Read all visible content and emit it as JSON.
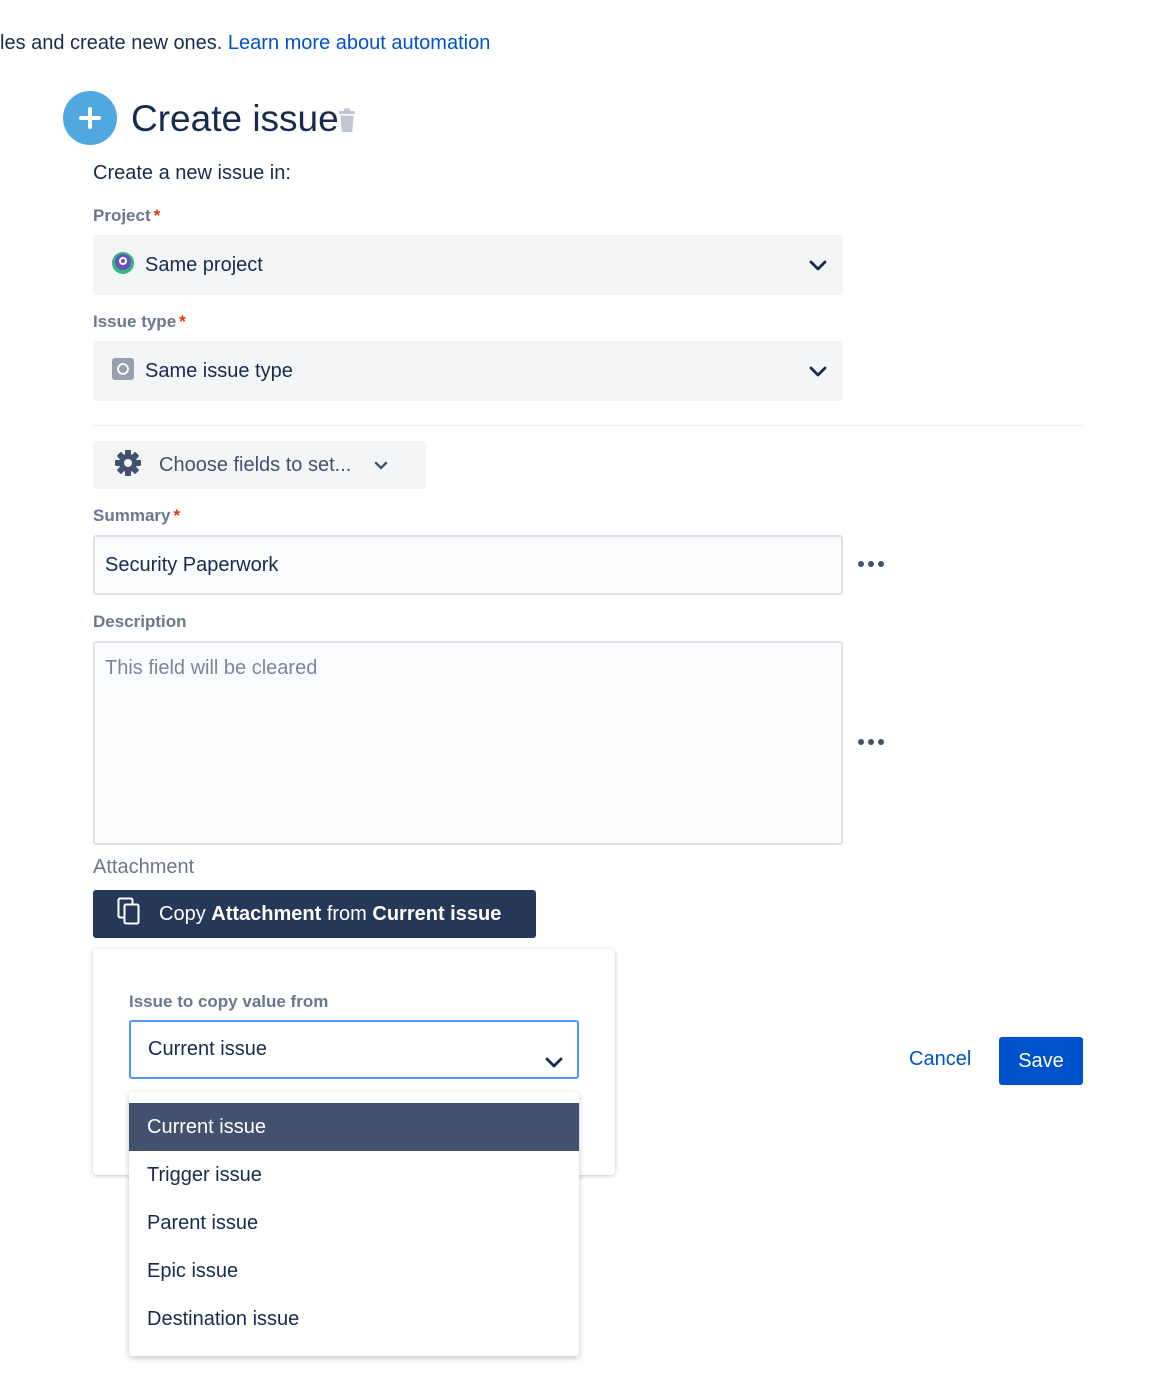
{
  "intro": {
    "text": "les and create new ones. ",
    "link": "Learn more about automation"
  },
  "header": {
    "title": "Create issue",
    "icon": "plus-icon",
    "delete_icon": "trash-icon"
  },
  "form": {
    "subheading": "Create a new issue in:",
    "project": {
      "label": "Project",
      "required": "*",
      "value": "Same project",
      "icon": "project-avatar-icon"
    },
    "issue_type": {
      "label": "Issue type",
      "required": "*",
      "value": "Same issue type",
      "icon": "issue-type-icon"
    },
    "choose_fields": {
      "label": "Choose fields to set...",
      "icon": "gear-icon"
    },
    "summary": {
      "label": "Summary",
      "required": "*",
      "value": "Security Paperwork"
    },
    "description": {
      "label": "Description",
      "placeholder": "This field will be cleared"
    },
    "attachment": {
      "label": "Attachment",
      "button": {
        "prefix": "Copy ",
        "field": "Attachment",
        "middle": " from ",
        "source": "Current issue"
      }
    }
  },
  "copy_panel": {
    "label": "Issue to copy value from",
    "selected": "Current issue",
    "options": [
      "Current issue",
      "Trigger issue",
      "Parent issue",
      "Epic issue",
      "Destination issue"
    ]
  },
  "actions": {
    "cancel": "Cancel",
    "save": "Save"
  },
  "colors": {
    "primary": "#0052cc",
    "dark_button": "#253858",
    "selected_option": "#42526e",
    "required": "#de350b",
    "focus_border": "#4c9aff"
  }
}
